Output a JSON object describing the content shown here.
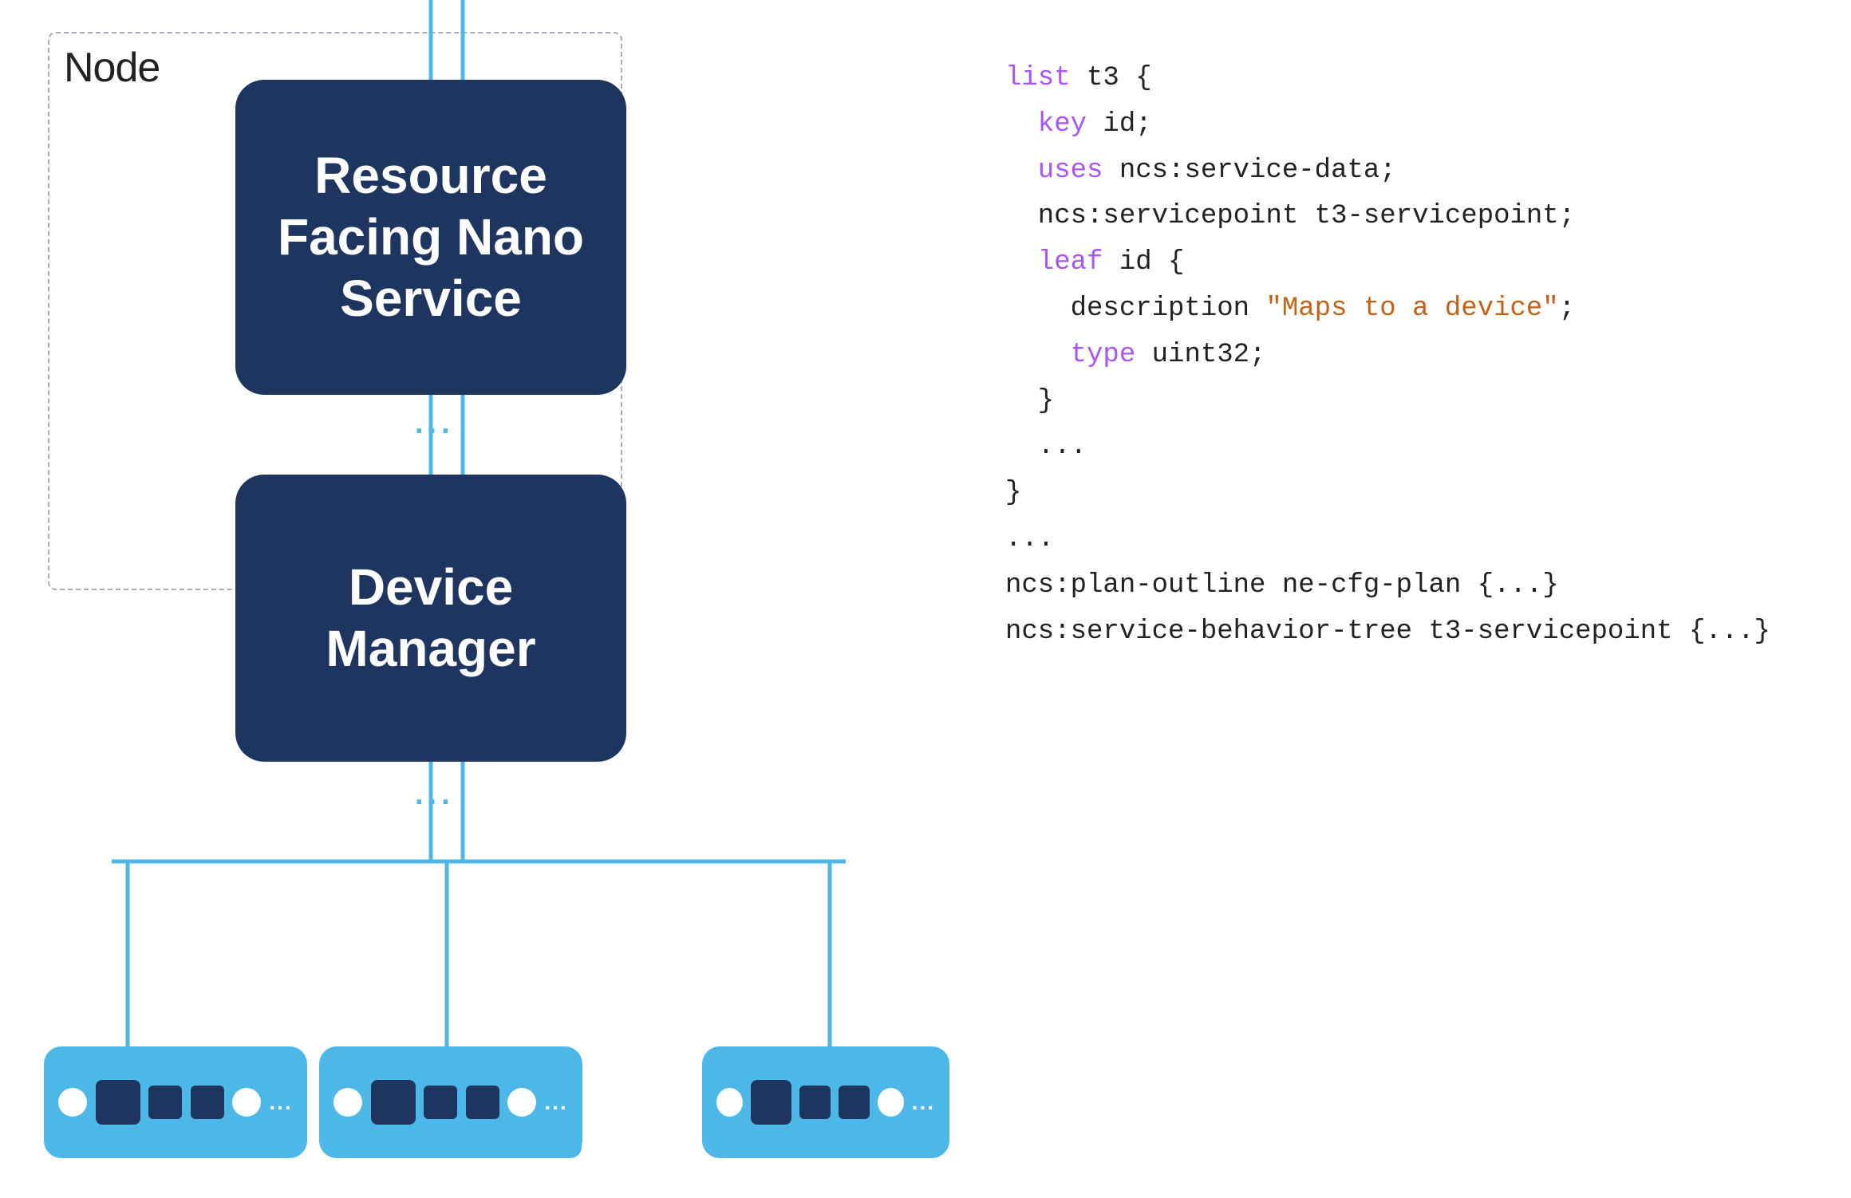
{
  "diagram": {
    "node_label": "Node",
    "rfns_label": "Resource\nFacing Nano\nService",
    "dm_label": "Device\nManager",
    "dots_vertical": "...",
    "dots_below": "..."
  },
  "code": {
    "lines": [
      {
        "text": "list t3 {",
        "parts": [
          {
            "cls": "c-purple",
            "t": "list"
          },
          {
            "cls": "c-default",
            "t": " t3 {"
          }
        ]
      },
      {
        "text": "  key id;",
        "parts": [
          {
            "cls": "c-purple",
            "t": "  key"
          },
          {
            "cls": "c-default",
            "t": " id;"
          }
        ]
      },
      {
        "text": "  uses ncs:service-data;",
        "parts": [
          {
            "cls": "c-purple",
            "t": "  uses"
          },
          {
            "cls": "c-default",
            "t": " ncs:service-data;"
          }
        ]
      },
      {
        "text": "  ncs:servicepoint t3-servicepoint;",
        "parts": [
          {
            "cls": "c-default",
            "t": "  ncs:servicepoint t3-servicepoint;"
          }
        ]
      },
      {
        "text": "  leaf id {",
        "parts": [
          {
            "cls": "c-purple",
            "t": "  leaf"
          },
          {
            "cls": "c-default",
            "t": " id {"
          }
        ]
      },
      {
        "text": "    description \"Maps to a device\";",
        "parts": [
          {
            "cls": "c-default",
            "t": "    description "
          },
          {
            "cls": "c-orange",
            "t": "\"Maps to a device\""
          },
          {
            "cls": "c-default",
            "t": ";"
          }
        ]
      },
      {
        "text": "    type uint32;",
        "parts": [
          {
            "cls": "c-purple",
            "t": "    type"
          },
          {
            "cls": "c-default",
            "t": " uint32;"
          }
        ]
      },
      {
        "text": "  }",
        "parts": [
          {
            "cls": "c-default",
            "t": "  }"
          }
        ]
      },
      {
        "text": "  ...",
        "parts": [
          {
            "cls": "c-default",
            "t": "  ..."
          }
        ]
      },
      {
        "text": "}",
        "parts": [
          {
            "cls": "c-default",
            "t": "}"
          }
        ]
      },
      {
        "text": "...",
        "parts": [
          {
            "cls": "c-default",
            "t": "..."
          }
        ]
      },
      {
        "text": "ncs:plan-outline ne-cfg-plan {...}",
        "parts": [
          {
            "cls": "c-default",
            "t": "ncs:plan-outline ne-cfg-plan {...}"
          }
        ]
      },
      {
        "text": "ncs:service-behavior-tree t3-servicepoint {...}",
        "parts": [
          {
            "cls": "c-default",
            "t": "ncs:service-behavior-tree t3-servicepoint {...}"
          }
        ]
      }
    ]
  }
}
